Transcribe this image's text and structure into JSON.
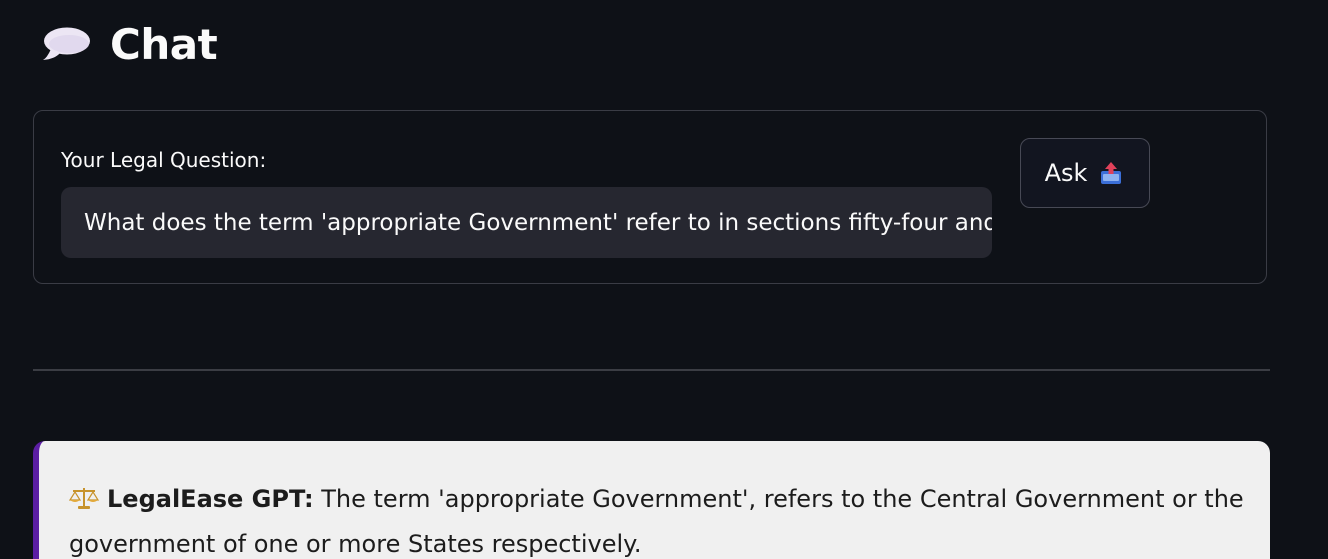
{
  "page": {
    "title": "Chat",
    "title_icon": "speech-balloon-icon"
  },
  "form": {
    "question_label": "Your Legal Question:",
    "question_value": "What does the term 'appropriate Government' refer to in sections fifty-four and",
    "ask_label": "Ask",
    "ask_icon": "outbox-tray-icon"
  },
  "answer": {
    "icon": "balance-scale-icon",
    "bot_name": "LegalEase GPT:",
    "line1": " The term 'appropriate Government', refers to the Central Government or the",
    "line2": "government of one or more States respectively."
  },
  "colors": {
    "background": "#0e1117",
    "input_background": "#262730",
    "answer_background": "#f0f0f0",
    "answer_accent": "#5b1ea3"
  }
}
